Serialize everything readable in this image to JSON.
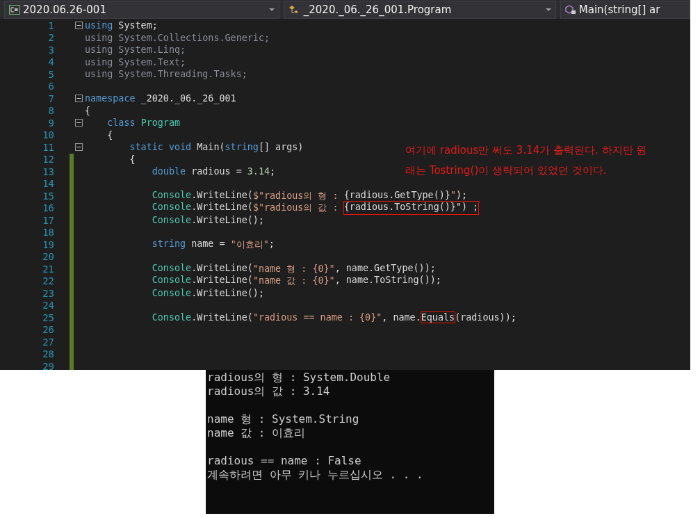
{
  "navigation_bar": {
    "project": "2020.06.26-001",
    "type": "_2020._06._26_001.Program",
    "member": "Main(string[] ar"
  },
  "code_lines": [
    {
      "number": "1",
      "fold": true,
      "changed": false,
      "tokens": [
        {
          "t": "using",
          "kind": "kw"
        },
        {
          "t": " System;",
          "kind": "plain"
        }
      ]
    },
    {
      "number": "2",
      "fold": false,
      "changed": false,
      "tokens": [
        {
          "t": "using System.Collections.Generic;",
          "kind": "faded"
        }
      ]
    },
    {
      "number": "3",
      "fold": false,
      "changed": false,
      "tokens": [
        {
          "t": "using System.Linq;",
          "kind": "faded"
        }
      ]
    },
    {
      "number": "4",
      "fold": false,
      "changed": false,
      "tokens": [
        {
          "t": "using System.Text;",
          "kind": "faded"
        }
      ]
    },
    {
      "number": "5",
      "fold": false,
      "changed": false,
      "tokens": [
        {
          "t": "using System.Threading.Tasks;",
          "kind": "faded"
        }
      ]
    },
    {
      "number": "6",
      "fold": false,
      "changed": false
    },
    {
      "number": "7",
      "fold": true,
      "changed": false,
      "tokens": [
        {
          "t": "namespace",
          "kind": "kw"
        },
        {
          "t": " _2020._06._26_001",
          "kind": "plain"
        }
      ]
    },
    {
      "number": "8",
      "fold": false,
      "changed": false,
      "tokens": [
        {
          "t": "{",
          "kind": "plain"
        }
      ]
    },
    {
      "number": "9",
      "fold": true,
      "changed": false,
      "tokens": [
        {
          "t": "    class ",
          "kind": "kw"
        },
        {
          "t": "Program",
          "kind": "type"
        }
      ]
    },
    {
      "number": "10",
      "fold": false,
      "changed": false,
      "tokens": [
        {
          "t": "    {",
          "kind": "plain"
        }
      ]
    },
    {
      "number": "11",
      "fold": true,
      "changed": false,
      "tokens": [
        {
          "t": "        static void",
          "kind": "kw"
        },
        {
          "t": " Main(",
          "kind": "plain"
        },
        {
          "t": "string",
          "kind": "kw"
        },
        {
          "t": "[] args)",
          "kind": "plain"
        }
      ]
    },
    {
      "number": "12",
      "fold": false,
      "changed": true,
      "tokens": [
        {
          "t": "        {",
          "kind": "plain"
        }
      ]
    },
    {
      "number": "13",
      "fold": false,
      "changed": true,
      "tokens": [
        {
          "t": "            double",
          "kind": "kw"
        },
        {
          "t": " radious = ",
          "kind": "plain"
        },
        {
          "t": "3.14",
          "kind": "num"
        },
        {
          "t": ";",
          "kind": "plain"
        }
      ]
    },
    {
      "number": "14",
      "fold": false,
      "changed": true
    },
    {
      "number": "15",
      "fold": false,
      "changed": true,
      "tokens": [
        {
          "t": "            Console",
          "kind": "type"
        },
        {
          "t": ".WriteLine(",
          "kind": "plain"
        },
        {
          "t": "$\"radious의 형 : ",
          "kind": "str"
        },
        {
          "t": "{radious.GetType()}",
          "kind": "plain"
        },
        {
          "t": "\"",
          "kind": "str"
        },
        {
          "t": ");",
          "kind": "plain"
        }
      ]
    },
    {
      "number": "16",
      "fold": false,
      "changed": true,
      "tokens": [
        {
          "t": "            Console",
          "kind": "type"
        },
        {
          "t": ".WriteLine(",
          "kind": "plain"
        },
        {
          "t": "$\"radious의 값 : ",
          "kind": "str"
        },
        {
          "t": "{radious.ToString()}\") ;",
          "kind": "boxed"
        }
      ]
    },
    {
      "number": "17",
      "fold": false,
      "changed": true,
      "tokens": [
        {
          "t": "            Console",
          "kind": "type"
        },
        {
          "t": ".WriteLine();",
          "kind": "plain"
        }
      ]
    },
    {
      "number": "18",
      "fold": false,
      "changed": true
    },
    {
      "number": "19",
      "fold": false,
      "changed": true,
      "tokens": [
        {
          "t": "            string",
          "kind": "kw"
        },
        {
          "t": " name = ",
          "kind": "plain"
        },
        {
          "t": "\"이효리\"",
          "kind": "str"
        },
        {
          "t": ";",
          "kind": "plain"
        }
      ]
    },
    {
      "number": "20",
      "fold": false,
      "changed": true
    },
    {
      "number": "21",
      "fold": false,
      "changed": true,
      "tokens": [
        {
          "t": "            Console",
          "kind": "type"
        },
        {
          "t": ".WriteLine(",
          "kind": "plain"
        },
        {
          "t": "\"name 형 : {0}\"",
          "kind": "str"
        },
        {
          "t": ", name.GetType());",
          "kind": "plain"
        }
      ]
    },
    {
      "number": "22",
      "fold": false,
      "changed": true,
      "tokens": [
        {
          "t": "            Console",
          "kind": "type"
        },
        {
          "t": ".WriteLine(",
          "kind": "plain"
        },
        {
          "t": "\"name 값 : {0}\"",
          "kind": "str"
        },
        {
          "t": ", name.ToString());",
          "kind": "plain"
        }
      ]
    },
    {
      "number": "23",
      "fold": false,
      "changed": true,
      "tokens": [
        {
          "t": "            Console",
          "kind": "type"
        },
        {
          "t": ".WriteLine();",
          "kind": "plain"
        }
      ]
    },
    {
      "number": "24",
      "fold": false,
      "changed": true
    },
    {
      "number": "25",
      "fold": false,
      "changed": true,
      "tokens": [
        {
          "t": "            Console",
          "kind": "type"
        },
        {
          "t": ".WriteLine(",
          "kind": "plain"
        },
        {
          "t": "\"radious == name : {0}\"",
          "kind": "str"
        },
        {
          "t": ", name.",
          "kind": "plain"
        },
        {
          "t": "Equals",
          "kind": "boxed"
        },
        {
          "t": "(radious));",
          "kind": "plain"
        }
      ]
    },
    {
      "number": "26",
      "fold": false,
      "changed": true
    },
    {
      "number": "27",
      "fold": false,
      "changed": true
    },
    {
      "number": "28",
      "fold": false,
      "changed": true
    },
    {
      "number": "29",
      "fold": false,
      "changed": true
    }
  ],
  "annotation": [
    "여기에 radious만 써도 3.14가 출력된다. 하지만 원",
    "래는 Tostring()이 생략되어 있었던 것이다."
  ],
  "console_output": [
    [
      "radious의 형 : System.Double",
      "radious의 값 : 3.14"
    ],
    [
      "name 형 : System.String",
      "name 값 : 이효리"
    ],
    [
      "radious == name : False",
      "계속하려면 아무 키나 누르십시오 . . ."
    ]
  ]
}
